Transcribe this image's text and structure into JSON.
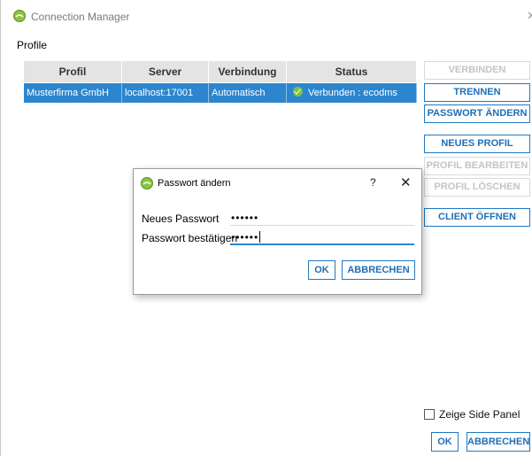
{
  "window": {
    "title": "Connection Manager",
    "close_glyph": "✕"
  },
  "profile_group": {
    "label": "Profile",
    "columns": [
      "Profil",
      "Server",
      "Verbindung",
      "Status"
    ],
    "rows": [
      {
        "profil": "Musterfirma GmbH",
        "server": "localhost:17001",
        "verbindung": "Automatisch",
        "status": "Verbunden : ecodms",
        "status_icon": "check-circle-icon"
      }
    ]
  },
  "side_buttons": [
    {
      "label": "VERBINDEN",
      "enabled": false
    },
    {
      "label": "TRENNEN",
      "enabled": true
    },
    {
      "label": "PASSWORT ÄNDERN",
      "enabled": true
    },
    {
      "label": "NEUES PROFIL",
      "enabled": true
    },
    {
      "label": "PROFIL BEARBEITEN",
      "enabled": false
    },
    {
      "label": "PROFIL LÖSCHEN",
      "enabled": false
    },
    {
      "label": "CLIENT ÖFFNEN",
      "enabled": true
    }
  ],
  "side_panel": {
    "label": "Zeige Side Panel",
    "checked": false
  },
  "footer": {
    "ok_label": "OK",
    "cancel_label": "ABBRECHEN"
  },
  "dialog": {
    "title": "Passwort ändern",
    "help_glyph": "?",
    "close_glyph": "✕",
    "new_password_label": "Neues Passwort",
    "new_password_value": "••••••",
    "confirm_password_label": "Passwort bestätigen",
    "confirm_password_value": "••••••",
    "ok_label": "OK",
    "cancel_label": "ABBRECHEN"
  },
  "colors": {
    "accent": "#1e7ac4",
    "selection": "#2d86cd",
    "status_ok": "#7cc24a",
    "logo": "#8bc540"
  }
}
